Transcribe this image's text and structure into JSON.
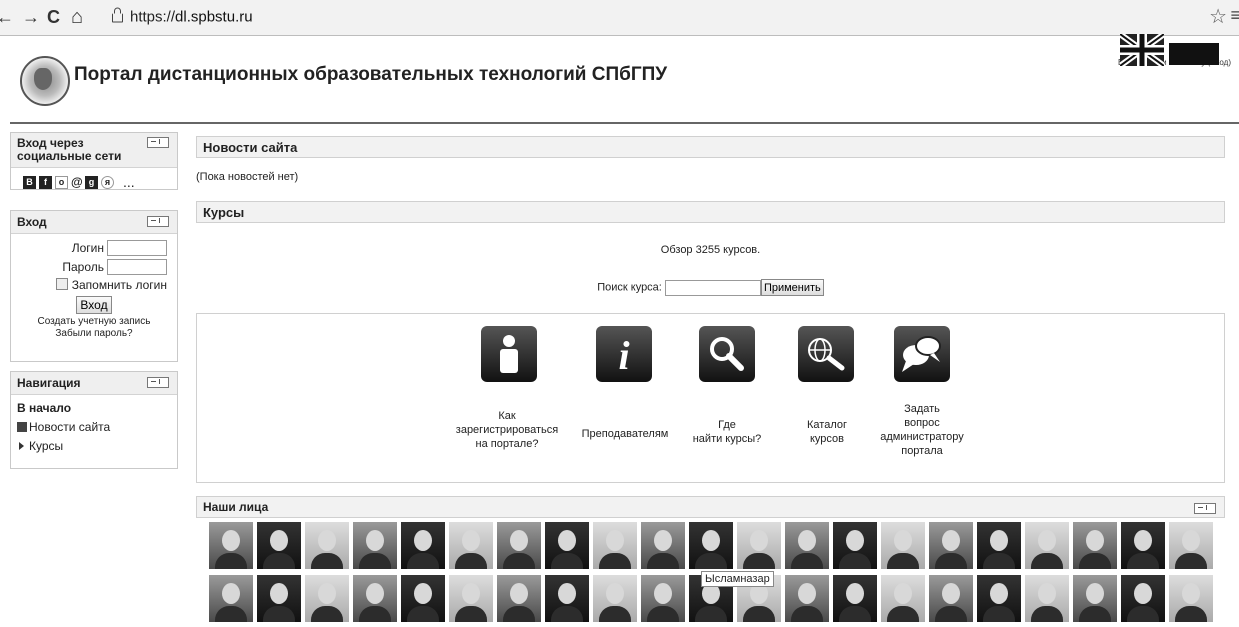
{
  "browser": {
    "back": "←",
    "forward": "→",
    "reload": "C",
    "home": "⌂",
    "url_scheme": "https://",
    "url_host": "dl.spbstu.ru"
  },
  "header": {
    "title": "Портал дистанционных образовательных технологий СПбГПУ",
    "login_status": "Вы не вошли в систему (Вход)"
  },
  "social_block": {
    "title": "Вход через социальные сети",
    "icons": [
      "В",
      "f",
      "о",
      "@",
      "g",
      "я"
    ],
    "more": "..."
  },
  "login_block": {
    "title": "Вход",
    "login_label": "Логин",
    "password_label": "Пароль",
    "remember_label": "Запомнить логин",
    "submit_label": "Вход",
    "create_account": "Создать учетную запись",
    "forgot_password": "Забыли пароль?"
  },
  "navigation_block": {
    "title": "Навигация",
    "home": "В начало",
    "items": [
      "Новости сайта",
      "Курсы"
    ]
  },
  "news": {
    "title": "Новости сайта",
    "empty": "(Пока новостей нет)"
  },
  "courses": {
    "title": "Курсы",
    "overview": "Обзор 3255 курсов.",
    "search_label": "Поиск курса:",
    "search_button": "Применить"
  },
  "quick_links": [
    {
      "label": "Как\nзарегистрироваться\nна портале?",
      "icon": "person-icon"
    },
    {
      "label": "Преподавателям",
      "icon": "info-icon"
    },
    {
      "label": "Где\nнайти курсы?",
      "icon": "magnifier-icon"
    },
    {
      "label": "Каталог\nкурсов",
      "icon": "globe-search-icon"
    },
    {
      "label": "Задать\nвопрос\nадминистратору\nпортала",
      "icon": "chat-bubbles-icon"
    }
  ],
  "faces": {
    "title": "Наши лица",
    "tooltip": "Ысламназар"
  }
}
